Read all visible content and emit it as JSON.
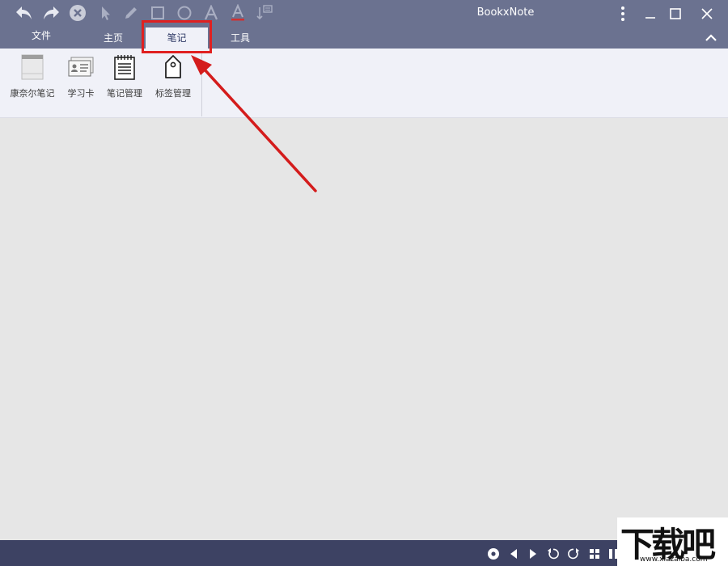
{
  "app": {
    "title": "BookxNote"
  },
  "toolbar": {
    "icons": [
      "undo-icon",
      "redo-icon",
      "close-circle-icon",
      "pointer-icon",
      "pen-icon",
      "rectangle-icon",
      "circle-icon",
      "text-icon",
      "text-color-icon",
      "insert-note-icon"
    ]
  },
  "window_controls": [
    "more-icon",
    "minimize-icon",
    "maximize-icon",
    "close-icon"
  ],
  "tabs": [
    {
      "label": "文件"
    },
    {
      "label": "主页"
    },
    {
      "label": "笔记",
      "active": true
    },
    {
      "label": "工具"
    }
  ],
  "ribbon": {
    "items": [
      {
        "label": "康奈尔笔记",
        "icon": "cornell-note-icon"
      },
      {
        "label": "学习卡",
        "icon": "study-card-icon"
      },
      {
        "label": "笔记管理",
        "icon": "note-manage-icon"
      },
      {
        "label": "标签管理",
        "icon": "tag-manage-icon"
      }
    ]
  },
  "statusbar": {
    "icons": [
      "settings-icon",
      "prev-page-icon",
      "next-page-icon",
      "rotate-left-icon",
      "rotate-right-icon",
      "grid-view-icon",
      "columns-icon"
    ]
  },
  "watermark": {
    "main": "下载吧",
    "sub": "www.xiazaiba.com"
  },
  "colors": {
    "titlebar": "#6b7290",
    "ribbon": "#f0f1f8",
    "statusbar": "#3d4263",
    "highlight": "#e02020",
    "workspace": "#e6e6e6"
  }
}
